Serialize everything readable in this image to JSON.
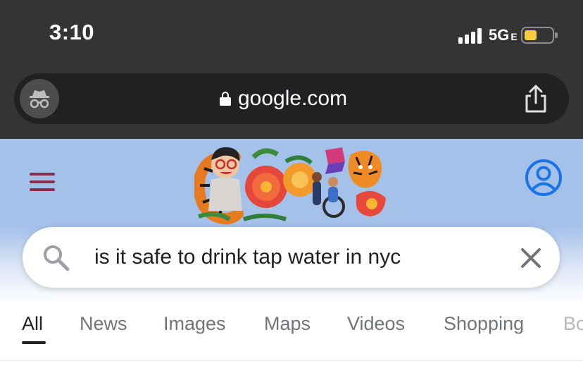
{
  "status_bar": {
    "time": "3:10",
    "network": "5G",
    "network_suffix": "E",
    "battery_color": "#f6cd3c"
  },
  "browser": {
    "url": "google.com",
    "incognito_icon": "incognito-icon",
    "share_icon": "share-icon",
    "lock_icon": "lock-icon",
    "background": "#343436"
  },
  "google": {
    "doodle": "google-doodle-logo",
    "menu_color": "#8c2d4f",
    "avatar_color": "#1a73e8",
    "hero_background": "#a4c1ea"
  },
  "search": {
    "query": "is it safe to drink tap water in nyc",
    "search_icon": "magnifier-icon",
    "clear_icon": "close-icon"
  },
  "tabs": [
    {
      "label": "All",
      "active": true
    },
    {
      "label": "News"
    },
    {
      "label": "Images"
    },
    {
      "label": "Maps"
    },
    {
      "label": "Videos"
    },
    {
      "label": "Shopping"
    },
    {
      "label": "Bo"
    }
  ]
}
